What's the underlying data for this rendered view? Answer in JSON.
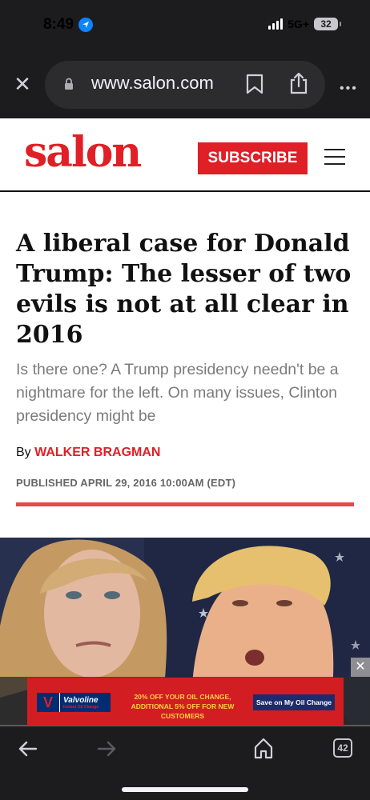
{
  "status": {
    "time": "8:49",
    "network": "5G+",
    "battery": "32"
  },
  "browser": {
    "url": "www.salon.com",
    "close_glyph": "✕",
    "more_glyph": "•••"
  },
  "site": {
    "logo": "salon",
    "subscribe_label": "SUBSCRIBE"
  },
  "article": {
    "headline": "A liberal case for Donald Trump: The lesser of two evils is not at all clear in 2016",
    "dek": "Is there one? A Trump presidency needn't be a nightmare for the left. On many issues, Clinton presidency might be",
    "byline_prefix": "By ",
    "author": "WALKER BRAGMAN",
    "published": "PUBLISHED APRIL 29, 2016 10:00AM (EDT)"
  },
  "ad": {
    "close_glyph": "✕",
    "logo_letter": "V",
    "brand": "Valvoline",
    "brand_sub": "Instant Oil Change",
    "copy_line1": "20% OFF YOUR OIL CHANGE,",
    "copy_line2": "ADDITIONAL 5% OFF FOR NEW CUSTOMERS",
    "cta": "Save on My Oil Change"
  },
  "toolbar": {
    "tab_count": "42"
  },
  "colors": {
    "brand_red": "#e01f26",
    "chrome_dark": "#1c1c1e",
    "ad_navy": "#1d2b6e",
    "ad_yellow": "#ffd23f"
  },
  "icons": [
    "location-arrow-icon",
    "signal-icon",
    "battery-icon",
    "close-icon",
    "lock-icon",
    "bookmark-icon",
    "share-icon",
    "more-icon",
    "menu-icon",
    "back-arrow-icon",
    "forward-arrow-icon",
    "home-icon",
    "tabs-icon"
  ]
}
